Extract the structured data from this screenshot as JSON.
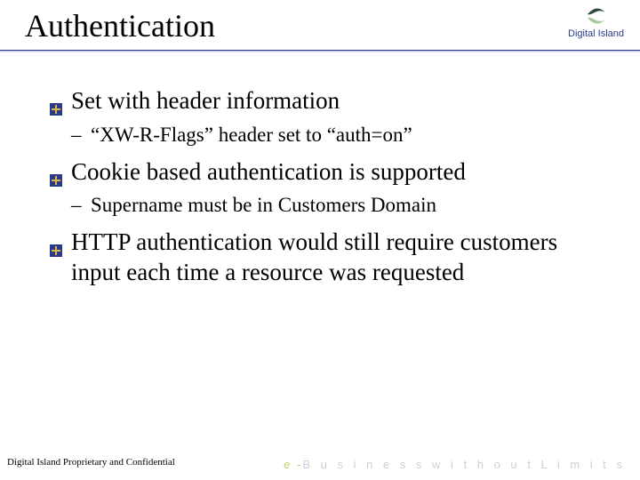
{
  "header": {
    "title": "Authentication",
    "logo": {
      "name_top": "Digital",
      "name_bottom": "Island"
    }
  },
  "bullets": [
    {
      "text": "Set with header information",
      "sub": [
        "“XW-R-Flags” header set to “auth=on”"
      ]
    },
    {
      "text": "Cookie based authentication is supported",
      "sub": [
        "Supername must be in Customers Domain"
      ]
    },
    {
      "text": "HTTP authentication would still require customers input each time a resource was requested",
      "sub": []
    }
  ],
  "footer": {
    "confidential": "Digital Island Proprietary and Confidential",
    "tagline_em": "e -",
    "tagline_rest": "B u s i n e s s   w i t h o u t   L i m i t s"
  }
}
